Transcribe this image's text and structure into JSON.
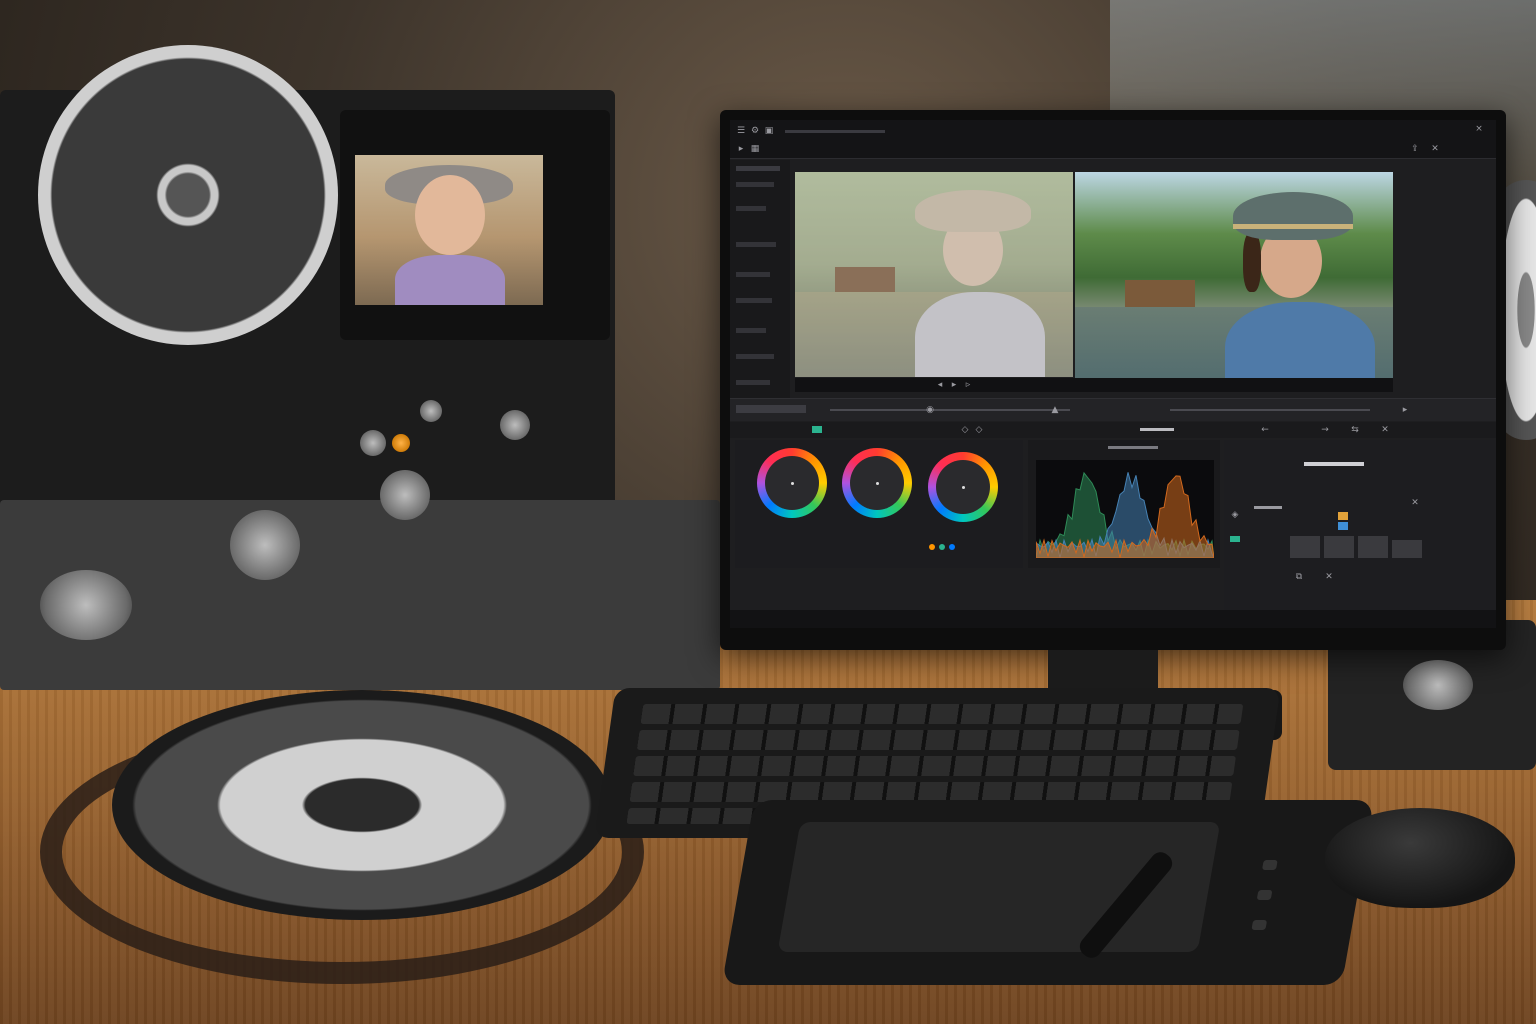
{
  "scene": {
    "palette": {
      "desk": "#a06a33",
      "monitor_bezel": "#0d0d0d",
      "app_background": "#1e1e20",
      "reel_metal": "#c8c8c8"
    },
    "objects": [
      "film-reel-icon",
      "film-scanner",
      "monitor",
      "keyboard",
      "pen-tablet",
      "stylus",
      "mouse"
    ]
  },
  "app": {
    "panels": [
      "viewer-before",
      "viewer-after",
      "color-wheels",
      "scopes",
      "inspector"
    ],
    "color_wheels": [
      {
        "id": "lift"
      },
      {
        "id": "gamma"
      },
      {
        "id": "gain"
      }
    ]
  },
  "chart_data": {
    "type": "area",
    "series": [
      {
        "color": "#2e8b57"
      },
      {
        "color": "#4682b4"
      },
      {
        "color": "#d2691e"
      }
    ]
  }
}
